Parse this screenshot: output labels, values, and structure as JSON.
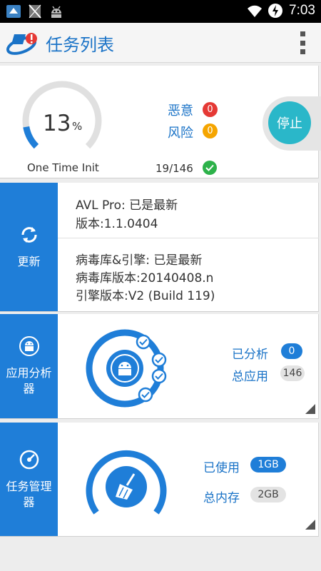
{
  "status_bar": {
    "time": "7:03",
    "left_icons": [
      "app-notification-icon",
      "no-sim-icon",
      "android-icon"
    ],
    "right_icons": [
      "wifi-icon",
      "battery-charging-icon"
    ]
  },
  "app_bar": {
    "title": "任务列表",
    "logo_icon": "app-logo-icon",
    "menu_icon": "overflow-menu-icon"
  },
  "scan": {
    "progress_value": "13",
    "progress_unit": "%",
    "progress_fraction": 0.13,
    "phase_label": "One Time Init",
    "malicious_label": "恶意",
    "malicious_count": "0",
    "risk_label": "风险",
    "risk_count": "0",
    "scanned_count": "19/146",
    "stop_label": "停止"
  },
  "update": {
    "tab_label": "更新",
    "engine_status": "AVL Pro: 已是最新",
    "engine_version": "版本:1.1.0404",
    "db_status": "病毒库&引擎: 已是最新",
    "db_version": "病毒库版本:20140408.n",
    "engine_build": "引擎版本:V2 (Build 119)"
  },
  "app_analyzer": {
    "tab_label": "应用分析器",
    "analyzed_label": "已分析",
    "analyzed_value": "0",
    "total_label": "总应用",
    "total_value": "146"
  },
  "task_manager": {
    "tab_label": "任务管理器",
    "used_label": "已使用",
    "used_value": "1GB",
    "total_mem_label": "总内存",
    "total_mem_value": "2GB"
  },
  "colors": {
    "accent_blue": "#1f7ed8",
    "title_blue": "#1a73c7",
    "danger_red": "#e53935",
    "warn_orange": "#f5a500",
    "ok_green": "#2db24a",
    "teal": "#2ab7c9"
  }
}
